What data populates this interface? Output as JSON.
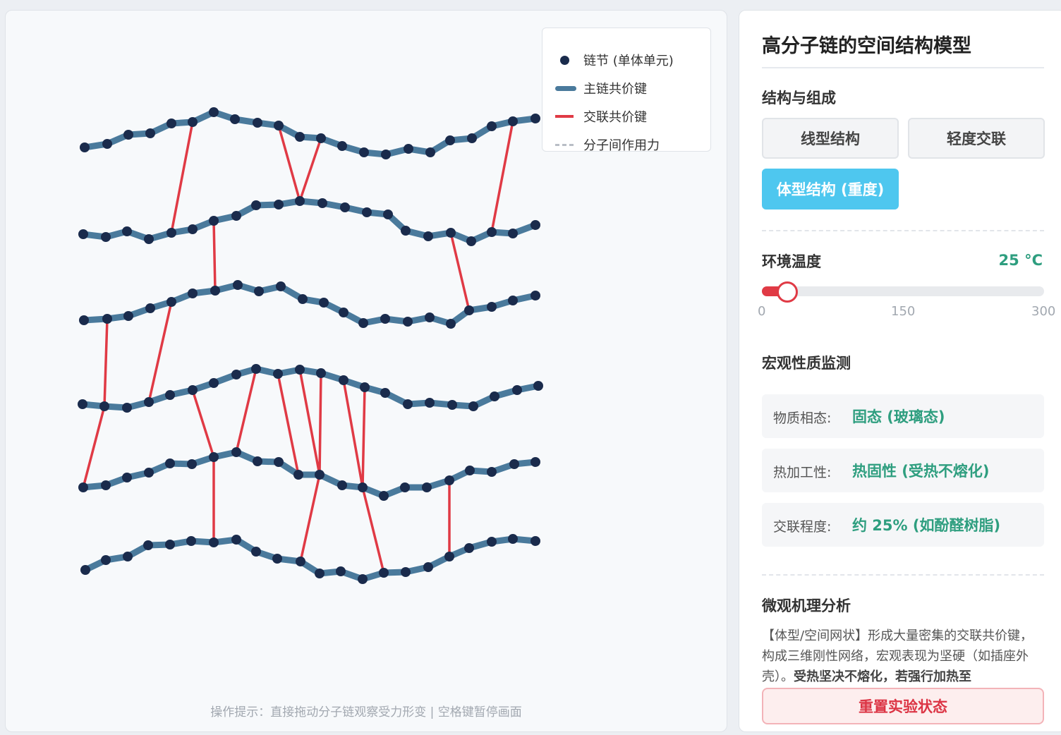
{
  "legend": {
    "node_label": "链节 (单体单元)",
    "main_bond_label": "主链共价键",
    "cross_bond_label": "交联共价键",
    "inter_force_label": "分子间作用力"
  },
  "hint": "操作提示：直接拖动分子链观察受力形变 | 空格键暂停画面",
  "panel": {
    "title": "高分子链的空间结构模型",
    "structure_section": "结构与组成",
    "buttons": {
      "linear": "线型结构",
      "light_crosslink": "轻度交联",
      "network": "体型结构 (重度)"
    },
    "active_structure": "体型结构 (重度)",
    "temperature_label": "环境温度",
    "temperature_value": "25 °C",
    "temperature_slider": {
      "min": 0,
      "max": 300,
      "value": 25
    },
    "ticks": [
      "0",
      "150",
      "300"
    ],
    "monitor_section": "宏观性质监测",
    "monitor": [
      {
        "label": "物质相态:",
        "value": "固态 (玻璃态)"
      },
      {
        "label": "热加工性:",
        "value": "热固性 (受热不熔化)"
      },
      {
        "label": "交联程度:",
        "value": "约 25% (如酚醛树脂)"
      }
    ],
    "analysis_section": "微观机理分析",
    "analysis_text": "【体型/空间网状】形成大量密集的交联共价键，构成三维刚性网络，宏观表现为坚硬（如插座外壳）。",
    "analysis_bold": "受热坚决不熔化，若强行加热至",
    "reset_label": "重置实验状态"
  },
  "colors": {
    "node": "#1a2b4c",
    "main_bond": "#4a7a9c",
    "cross_bond": "#e03a45",
    "accent_value": "#2e9e7f",
    "active_button": "#4ec7ef"
  }
}
